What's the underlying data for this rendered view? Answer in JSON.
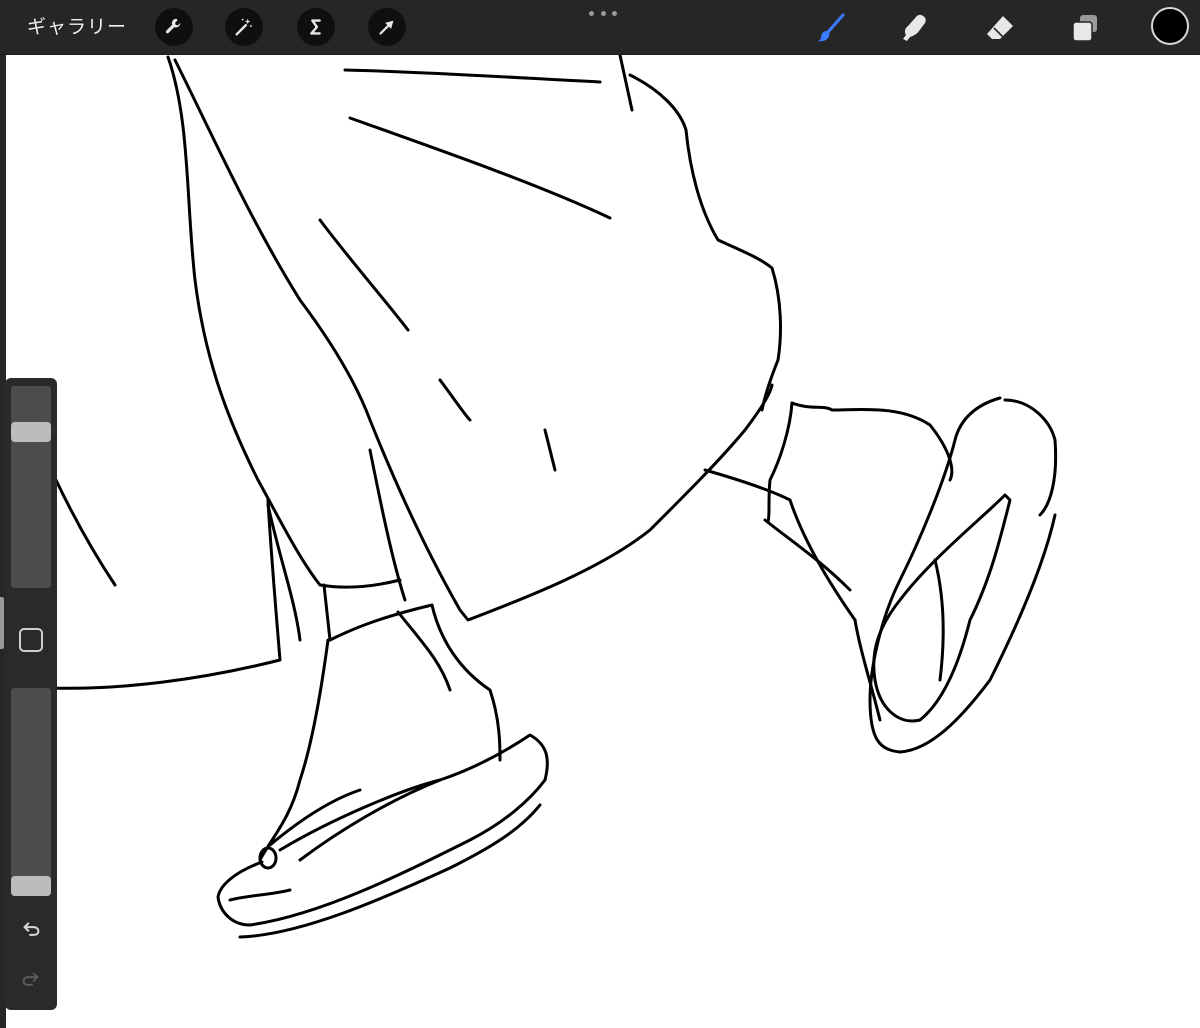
{
  "app": {
    "gallery_label": "ギャラリー",
    "accent_color": "#3b7bff",
    "current_color": "#000000"
  },
  "toolbar_left": [
    {
      "name": "actions",
      "icon": "wrench-icon"
    },
    {
      "name": "adjustments",
      "icon": "magic-wand-icon"
    },
    {
      "name": "selection",
      "icon": "selection-s-icon"
    },
    {
      "name": "transform",
      "icon": "arrow-cursor-icon"
    }
  ],
  "toolbar_right": [
    {
      "name": "brush",
      "icon": "brush-icon",
      "active": true
    },
    {
      "name": "smudge",
      "icon": "smudge-finger-icon",
      "active": false
    },
    {
      "name": "eraser",
      "icon": "eraser-icon",
      "active": false
    },
    {
      "name": "layers",
      "icon": "layers-icon",
      "active": false
    }
  ],
  "sidebar": {
    "brush_size_level": 0.8,
    "opacity_level": 0.0,
    "undo_icon": "undo-icon",
    "redo_icon": "redo-icon",
    "modify_icon": "square-modify-icon"
  }
}
